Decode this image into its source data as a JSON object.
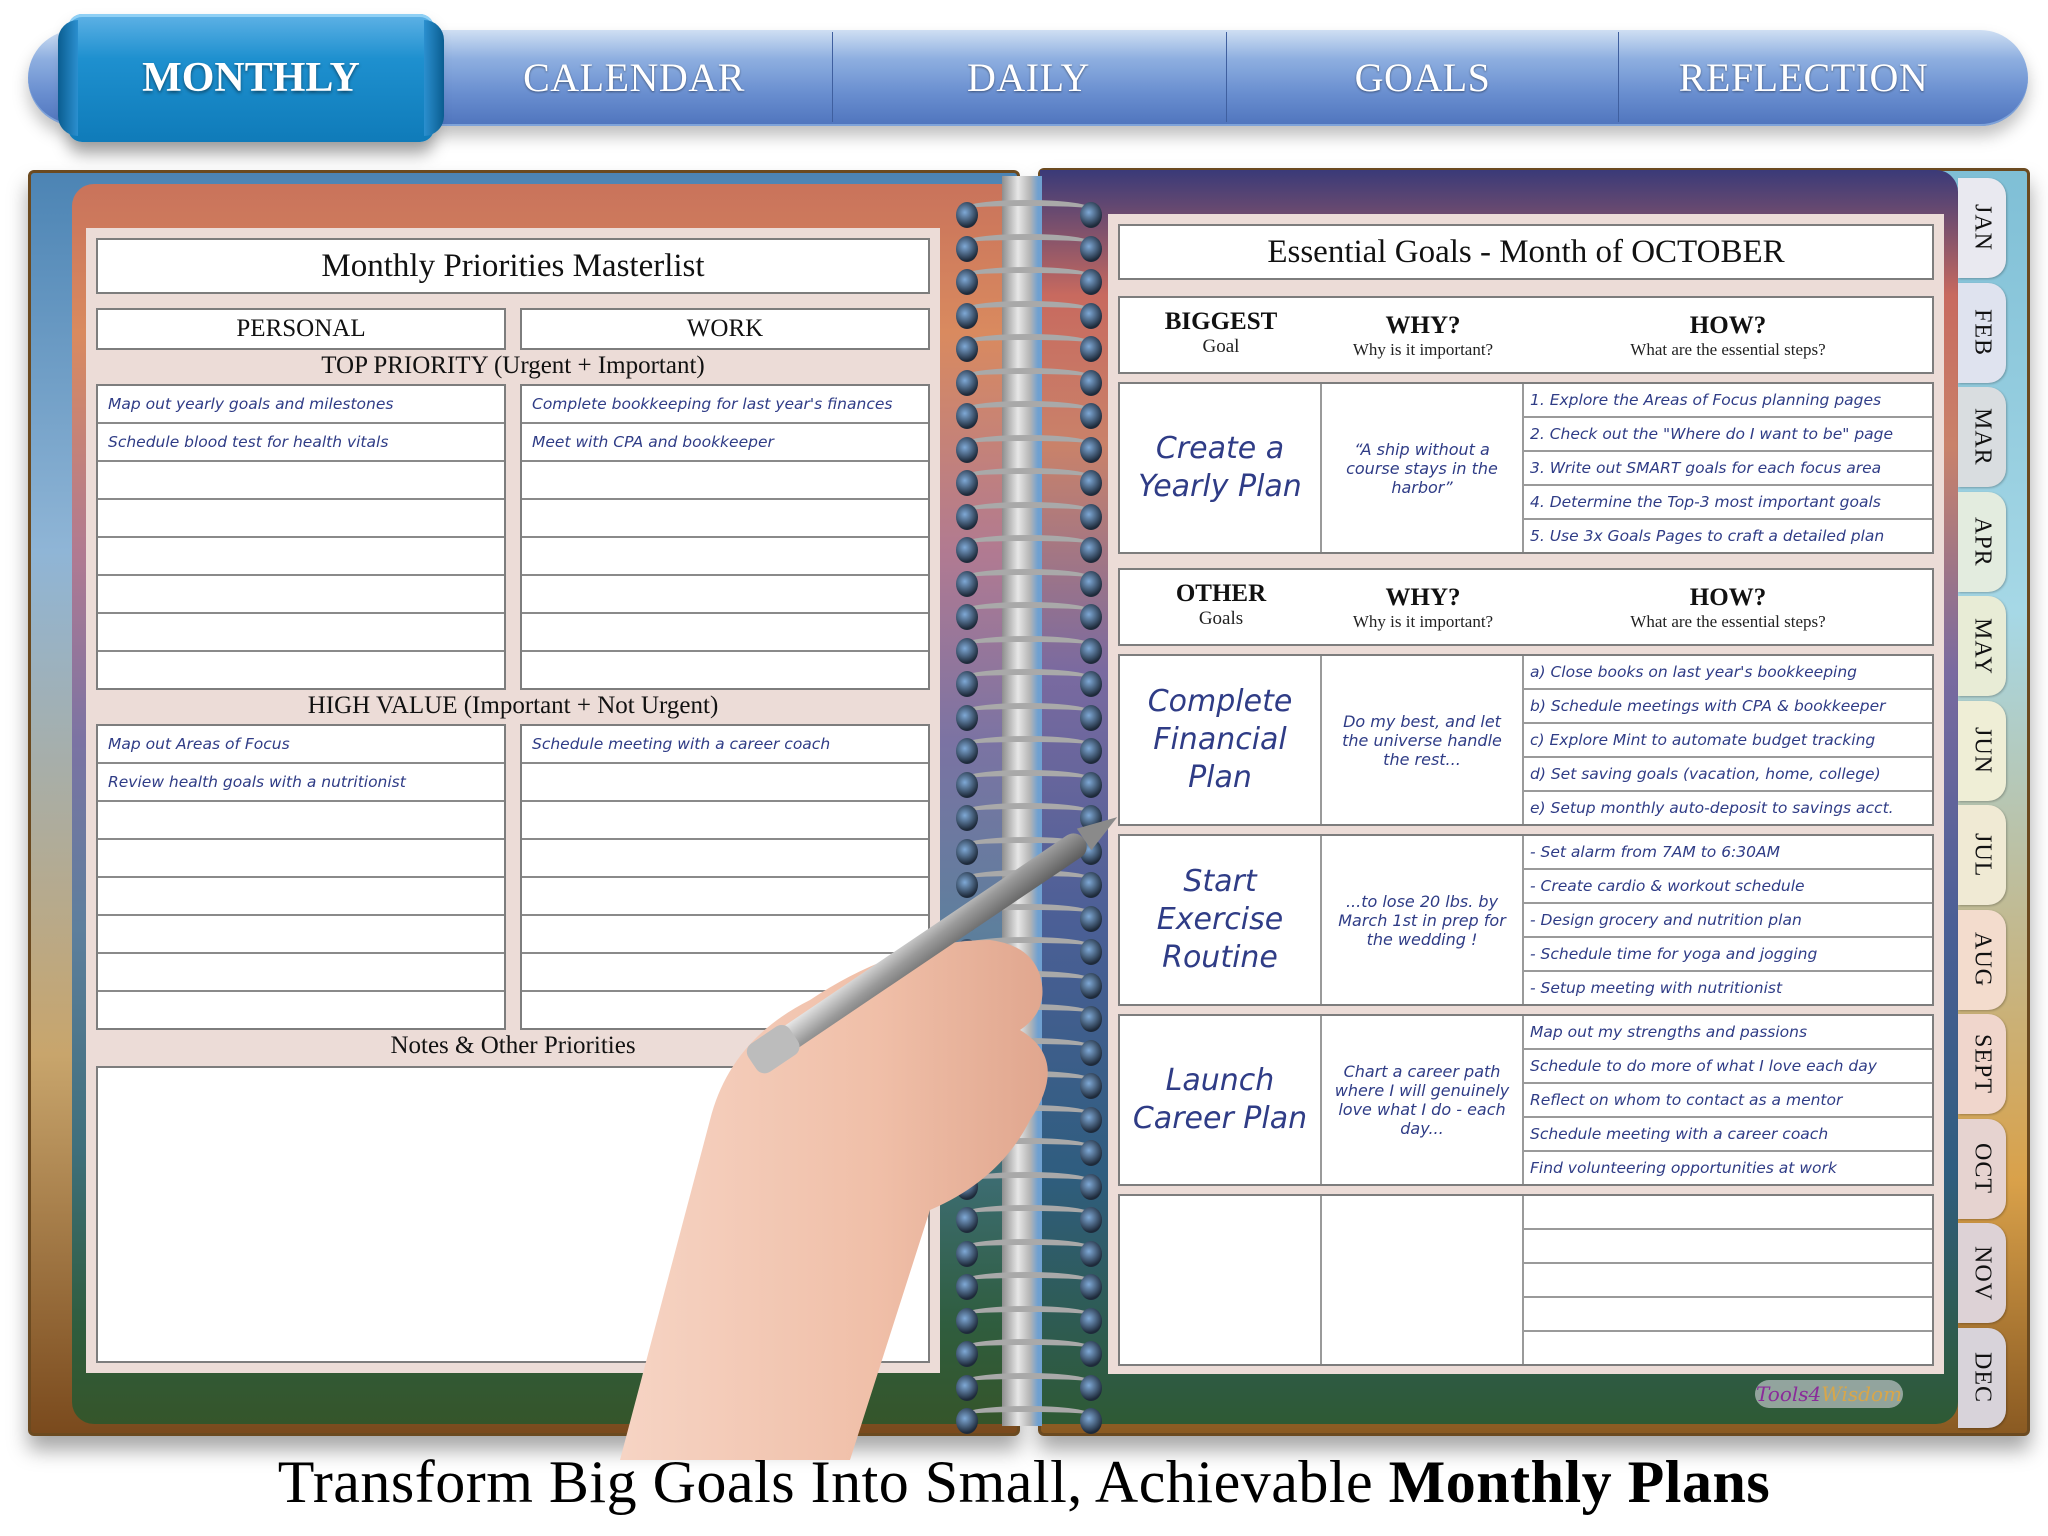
{
  "nav": {
    "active_tab": "MONTHLY",
    "tabs": [
      "CALENDAR",
      "DAILY",
      "GOALS",
      "REFLECTION"
    ]
  },
  "left_page": {
    "title": "Monthly Priorities Masterlist",
    "columns": [
      "PERSONAL",
      "WORK"
    ],
    "top_priority": {
      "heading": "TOP PRIORITY (Urgent + Important)",
      "personal": [
        "Map out yearly goals and milestones",
        "Schedule blood test for health vitals",
        "",
        "",
        "",
        "",
        "",
        ""
      ],
      "work": [
        "Complete bookkeeping for last year's finances",
        "Meet with CPA and bookkeeper",
        "",
        "",
        "",
        "",
        "",
        ""
      ]
    },
    "high_value": {
      "heading": "HIGH VALUE (Important + Not Urgent)",
      "personal": [
        "Map out Areas of Focus",
        "Review health goals with a nutritionist",
        "",
        "",
        "",
        "",
        "",
        ""
      ],
      "work": [
        "Schedule meeting with a career coach",
        "",
        "",
        "",
        "",
        "",
        "",
        ""
      ]
    },
    "notes": {
      "heading": "Notes & Other Priorities",
      "content": ""
    }
  },
  "right_page": {
    "title": "Essential Goals - Month of OCTOBER",
    "biggest_header": {
      "label_top": "BIGGEST",
      "label_bottom": "Goal",
      "why": "WHY?",
      "why_sub": "Why is it important?",
      "how": "HOW?",
      "how_sub": "What are the essential steps?"
    },
    "biggest_goal": {
      "name": "Create a Yearly Plan",
      "why": "“A ship without a course stays in the harbor”",
      "how": [
        "1. Explore the Areas of Focus planning pages",
        "2. Check out the \"Where do I want to be\" page",
        "3. Write out SMART goals for each focus area",
        "4. Determine the Top-3 most important goals",
        "5. Use 3x Goals Pages to craft a detailed plan"
      ]
    },
    "other_header": {
      "label_top": "OTHER",
      "label_bottom": "Goals",
      "why": "WHY?",
      "why_sub": "Why is it important?",
      "how": "HOW?",
      "how_sub": "What are the essential steps?"
    },
    "other_goals": [
      {
        "name": "Complete Financial Plan",
        "why": "Do my best, and let the universe handle the rest...",
        "how": [
          "a) Close books on last year's bookkeeping",
          "b) Schedule meetings with CPA & bookkeeper",
          "c) Explore Mint to automate budget tracking",
          "d) Set saving goals (vacation, home, college)",
          "e) Setup monthly auto-deposit to savings acct."
        ]
      },
      {
        "name": "Start Exercise Routine",
        "why": "...to lose 20 lbs. by March 1st in prep for the wedding !",
        "how": [
          "- Set alarm from 7AM to 6:30AM",
          "- Create cardio & workout schedule",
          "- Design grocery and nutrition plan",
          "- Schedule time for yoga and jogging",
          "- Setup meeting with nutritionist"
        ]
      },
      {
        "name": "Launch Career Plan",
        "why": "Chart a career path where I will genuinely love what I do - each day...",
        "how": [
          "Map out my strengths and passions",
          "Schedule to do more of what I love each day",
          "Reflect on whom to contact as a mentor",
          "Schedule meeting with a career coach",
          "Find volunteering opportunities at work"
        ]
      },
      {
        "name": "",
        "why": "",
        "how": [
          "",
          "",
          "",
          "",
          ""
        ]
      }
    ]
  },
  "month_tabs": [
    {
      "label": "JAN",
      "color": "#e9e9f0"
    },
    {
      "label": "FEB",
      "color": "#dfe3ef"
    },
    {
      "label": "MAR",
      "color": "#d9dde0"
    },
    {
      "label": "APR",
      "color": "#e3ecdf"
    },
    {
      "label": "MAY",
      "color": "#e8ecd6"
    },
    {
      "label": "JUN",
      "color": "#efeed6"
    },
    {
      "label": "JUL",
      "color": "#f0ead4"
    },
    {
      "label": "AUG",
      "color": "#f3dccd"
    },
    {
      "label": "SEPT",
      "color": "#f0d6cc"
    },
    {
      "label": "OCT",
      "color": "#e6d3d0"
    },
    {
      "label": "NOV",
      "color": "#ddd2d6"
    },
    {
      "label": "DEC",
      "color": "#d8d3da"
    }
  ],
  "brand": {
    "part1": "Tools4",
    "part2": "Wisdom"
  },
  "tagline": {
    "regular": "Transform Big Goals Into Small, Achievable ",
    "bold": "Monthly Plans"
  }
}
